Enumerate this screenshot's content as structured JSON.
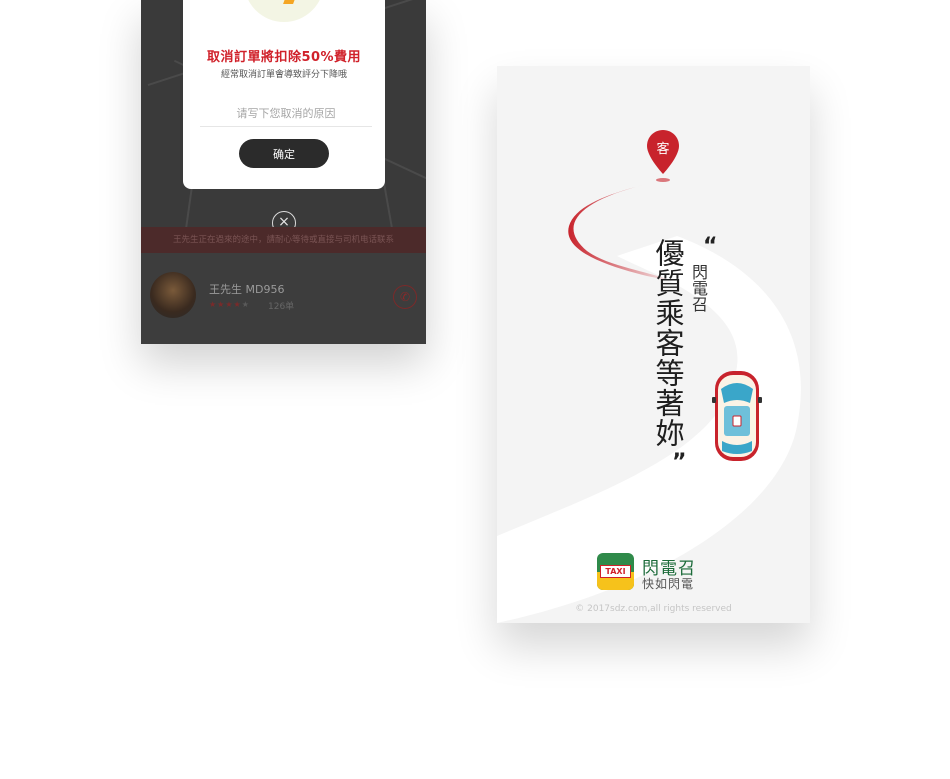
{
  "cancel_screen": {
    "dialog_title": "取消訂單將扣除50%費用",
    "dialog_subtitle": "經常取消訂單會導致評分下降哦",
    "reason_placeholder": "请写下您取消的原因",
    "confirm_label": "确定",
    "close_symbol": "×",
    "notice_text": "王先生正在過來的途中，請耐心等待或直接与司机电话联系",
    "driver": {
      "name_plate": "王先生 MD956",
      "rating": 4,
      "max_rating": 5,
      "stars_filled": "★★★★",
      "stars_empty": "★",
      "orders": "126单"
    },
    "accent_color": "#d0212a"
  },
  "splash_screen": {
    "pin_label": "客",
    "slogan": "優質乘客等著妳",
    "slogan_brand": "閃電召",
    "quote_open": "“",
    "quote_close": "”",
    "brand_logo_text": "TAXI",
    "brand_name": "閃電召",
    "brand_tagline": "快如閃電",
    "copyright": "© 2017sdz.com,all rights reserved",
    "accent_color": "#c8232c",
    "brand_color": "#1c6b3a"
  }
}
